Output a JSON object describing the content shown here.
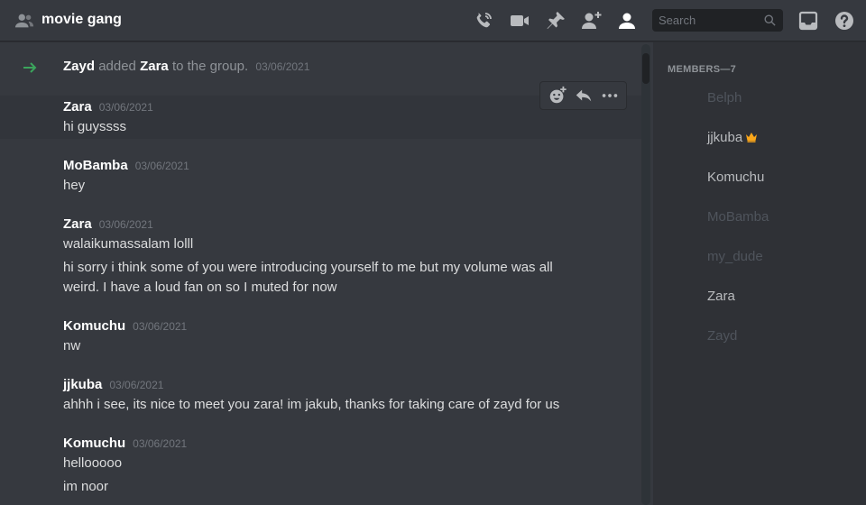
{
  "header": {
    "title": "movie gang",
    "search_placeholder": "Search",
    "icons": [
      "group-icon",
      "voice-call-icon",
      "video-call-icon",
      "pin-icon",
      "add-friend-icon",
      "member-list-icon",
      "search-icon",
      "inbox-icon",
      "help-icon"
    ]
  },
  "system_message": {
    "actor": "Zayd",
    "action": "added",
    "target": "Zara",
    "suffix": "to the group.",
    "timestamp": "03/06/2021"
  },
  "messages": [
    {
      "author": "Zara",
      "timestamp": "03/06/2021",
      "lines": [
        "hi guyssss"
      ]
    },
    {
      "author": "MoBamba",
      "timestamp": "03/06/2021",
      "lines": [
        "hey"
      ]
    },
    {
      "author": "Zara",
      "timestamp": "03/06/2021",
      "lines": [
        "walaikumassalam lolll",
        "hi sorry i think some of you were introducing yourself to me but my volume was all weird. I have a loud fan on so I muted for now"
      ]
    },
    {
      "author": "Komuchu",
      "timestamp": "03/06/2021",
      "lines": [
        "nw"
      ]
    },
    {
      "author": "jjkuba",
      "timestamp": "03/06/2021",
      "lines": [
        "ahhh i see, its nice to meet you zara! im jakub, thanks for taking care of zayd for us"
      ]
    },
    {
      "author": "Komuchu",
      "timestamp": "03/06/2021",
      "lines": [
        "hellooooo",
        "im noor"
      ]
    }
  ],
  "members": {
    "header": "MEMBERS—7",
    "list": [
      {
        "name": "Belph",
        "status": "offline"
      },
      {
        "name": "jjkuba",
        "status": "online",
        "owner": true
      },
      {
        "name": "Komuchu",
        "status": "online"
      },
      {
        "name": "MoBamba",
        "status": "offline"
      },
      {
        "name": "my_dude",
        "status": "offline"
      },
      {
        "name": "Zara",
        "status": "online"
      },
      {
        "name": "Zayd",
        "status": "offline"
      }
    ]
  },
  "colors": {
    "background": "#36393f",
    "sidebar": "#2f3136",
    "accent_green": "#3ba55c",
    "crown": "#faa61a"
  }
}
